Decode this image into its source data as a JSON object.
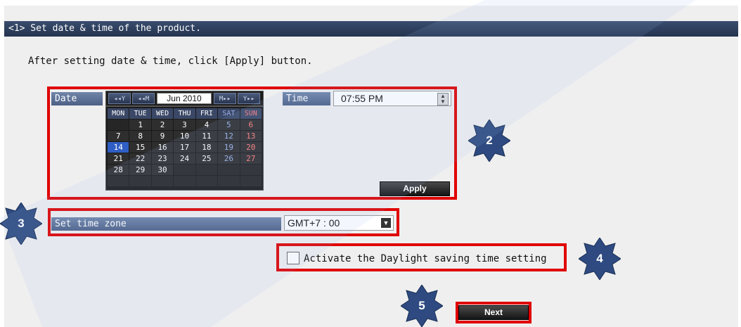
{
  "section_title": "<1> Set date & time of the product.",
  "instruction": "After setting date & time, click [Apply] button.",
  "date": {
    "label": "Date",
    "prev_year": "◂◂Y",
    "prev_month": "◂◂M",
    "month_year": "Jun 2010",
    "next_month": "M▸▸",
    "next_year": "Y▸▸",
    "weekdays": [
      "MON",
      "TUE",
      "WED",
      "THU",
      "FRI",
      "SAT",
      "SUN"
    ],
    "weeks": [
      [
        "",
        "1",
        "2",
        "3",
        "4",
        "5",
        "6"
      ],
      [
        "7",
        "8",
        "9",
        "10",
        "11",
        "12",
        "13"
      ],
      [
        "14",
        "15",
        "16",
        "17",
        "18",
        "19",
        "20"
      ],
      [
        "21",
        "22",
        "23",
        "24",
        "25",
        "26",
        "27"
      ],
      [
        "28",
        "29",
        "30",
        "",
        "",
        "",
        ""
      ],
      [
        "",
        "",
        "",
        "",
        "",
        "",
        ""
      ]
    ],
    "selected_day": "14"
  },
  "time": {
    "label": "Time",
    "value": "07:55 PM",
    "spinner_icon": "spinner-icon"
  },
  "apply_label": "Apply",
  "timezone": {
    "label": "Set time zone",
    "value": "GMT+7 : 00",
    "dropdown_icon": "dropdown-arrow-icon"
  },
  "dst_label": "Activate the Daylight saving time setting",
  "next_label": "Next",
  "callouts": [
    "2",
    "3",
    "4",
    "5"
  ],
  "colors": {
    "highlight": "#e00000",
    "callout": "#2e4a80",
    "header_bar": "#2a3a5a"
  }
}
